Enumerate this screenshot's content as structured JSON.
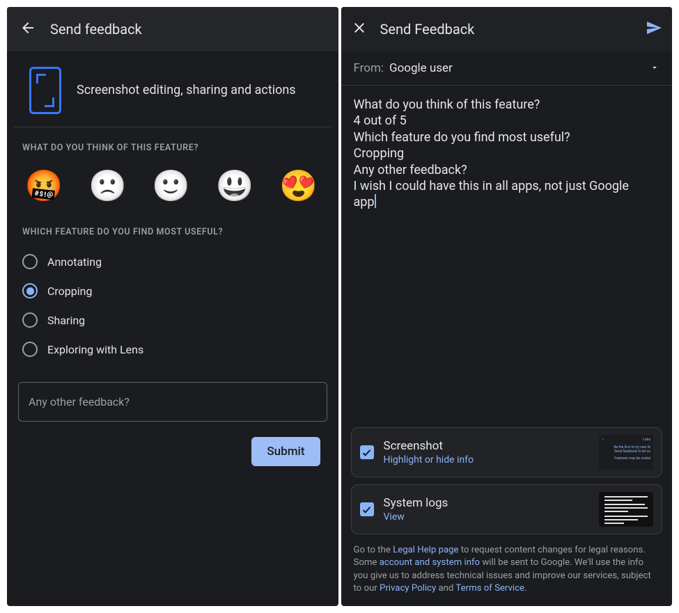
{
  "left": {
    "title": "Send feedback",
    "hero": "Screenshot editing, sharing and actions",
    "q1_label": "WHAT DO YOU THINK OF THIS FEATURE?",
    "emojis": {
      "e1": "😡",
      "e2": "🙁",
      "e3": "🙂",
      "e4": "😃",
      "e5": "😍"
    },
    "q2_label": "WHICH FEATURE DO YOU FIND MOST USEFUL?",
    "radios": {
      "r0": "Annotating",
      "r1": "Cropping",
      "r2": "Sharing",
      "r3": "Exploring with Lens"
    },
    "selected_radio": 1,
    "q3_placeholder": "Any other feedback?",
    "submit_label": "Submit"
  },
  "right": {
    "title": "Send Feedback",
    "from_label": "From:",
    "from_value": "Google user",
    "body_lines": {
      "l0": "What do you think of this feature?",
      "l1": "4 out of 5",
      "l2": "Which feature do you find most useful?",
      "l3": "Cropping",
      "l4": "Any other feedback?",
      "l5a": "I wish I could have this in all apps, not just Google",
      "l5b": "app"
    },
    "attachments": {
      "screenshot_title": "Screenshot",
      "screenshot_link": "Highlight or hide info",
      "syslogs_title": "System logs",
      "syslogs_link": "View",
      "thumb_labs": "Labs",
      "thumb_line1": "Be the first to try new fe",
      "thumb_line2": "Send feedback to let us",
      "thumb_line3": "Features may be unstal"
    },
    "footer": {
      "t1": "Go to the ",
      "link1": "Legal Help page",
      "t2": " to request content changes for legal reasons.",
      "t3": "Some ",
      "link2": "account and system info",
      "t4": " will be sent to Google. We'll use the info you give us to address technical issues and improve our services, subject to our ",
      "link3": "Privacy Policy",
      "t5": " and ",
      "link4": "Terms of Service",
      "t6": "."
    }
  }
}
